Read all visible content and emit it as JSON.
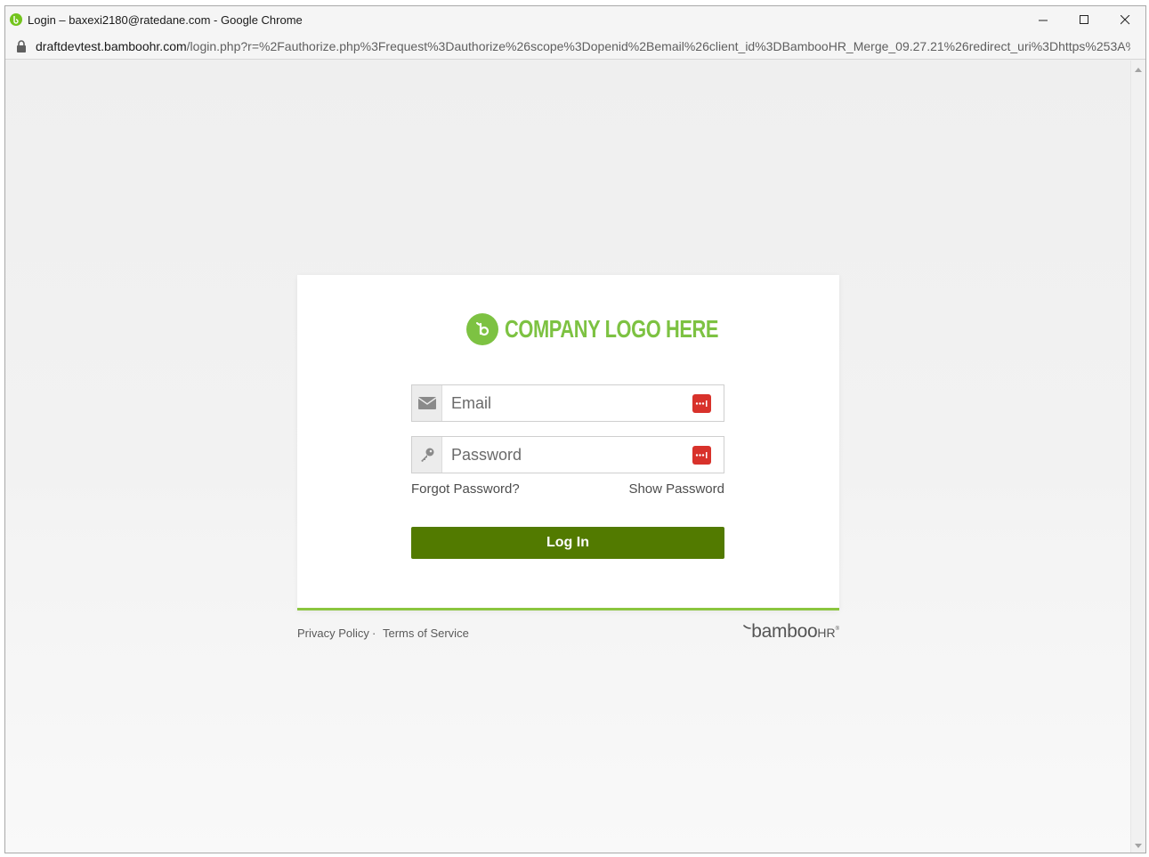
{
  "window": {
    "title": "Login – baxexi2180@ratedane.com - Google Chrome"
  },
  "address": {
    "host": "draftdevtest.bamboohr.com",
    "path": "/login.php?r=%2Fauthorize.php%3Frequest%3Dauthorize%26scope%3Dopenid%2Bemail%26client_id%3DBambooHR_Merge_09.27.21%26redirect_uri%3Dhttps%253A%2..."
  },
  "login": {
    "logo_text": "COMPANY LOGO HERE",
    "email_placeholder": "Email",
    "password_placeholder": "Password",
    "forgot_password": "Forgot Password?",
    "show_password": "Show Password",
    "login_button": "Log In"
  },
  "footer": {
    "privacy": "Privacy Policy",
    "separator": "·",
    "terms": "Terms of Service",
    "brand_main": "bamboo",
    "brand_hr": "HR",
    "brand_reg": "®"
  },
  "colors": {
    "accent_green": "#7dc242",
    "button_green": "#527a00",
    "password_manager_red": "#d8322b"
  },
  "icons": {
    "favicon": "bamboohr-favicon-icon",
    "lock": "lock-icon",
    "email": "envelope-icon",
    "password": "key-icon",
    "password_manager": "password-manager-icon"
  }
}
